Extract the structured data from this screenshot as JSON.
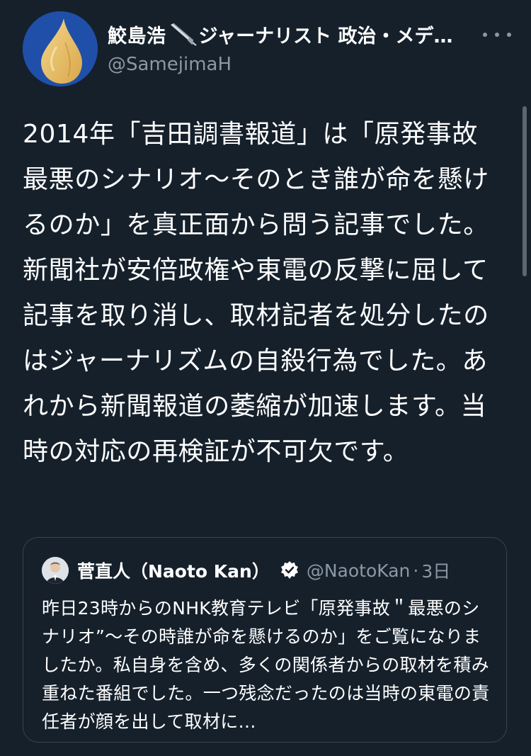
{
  "tweet": {
    "author": {
      "name": "鮫島浩",
      "name_suffix": "ジャーナリスト 政治・メデ…",
      "handle": "@SamejimaH",
      "avatar_icon": "drop-avatar-icon",
      "pen_icon": "fountain-pen-icon"
    },
    "more_icon": "more-options-icon",
    "text": "2014年「吉田調書報道」は「原発事故最悪のシナリオ〜そのとき誰が命を懸けるのか」を真正面から問う記事でした。新聞社が安倍政権や東電の反撃に屈して記事を取り消し、取材記者を処分したのはジャーナリズムの自殺行為でした。あれから新聞報道の萎縮が加速します。当時の対応の再検証が不可欠です。"
  },
  "quoted": {
    "name": "菅直人（Naoto Kan）",
    "verified_icon": "verified-badge-icon",
    "handle": "@NaotoKan",
    "separator": "·",
    "time": "3日",
    "text": "昨日23時からのNHK教育テレビ「原発事故＂最悪のシナリオ”〜その時誰が命を懸けるのか」をご覧になりましたか。私自身を含め、多くの関係者からの取材を積み重ねた番組でした。一つ残念だったのは当時の東電の責任者が顔を出して取材に…"
  },
  "colors": {
    "background": "#15202b",
    "text": "#ffffff",
    "secondary": "#8b98a5",
    "border": "#38444d",
    "verified": "#ffffff"
  }
}
